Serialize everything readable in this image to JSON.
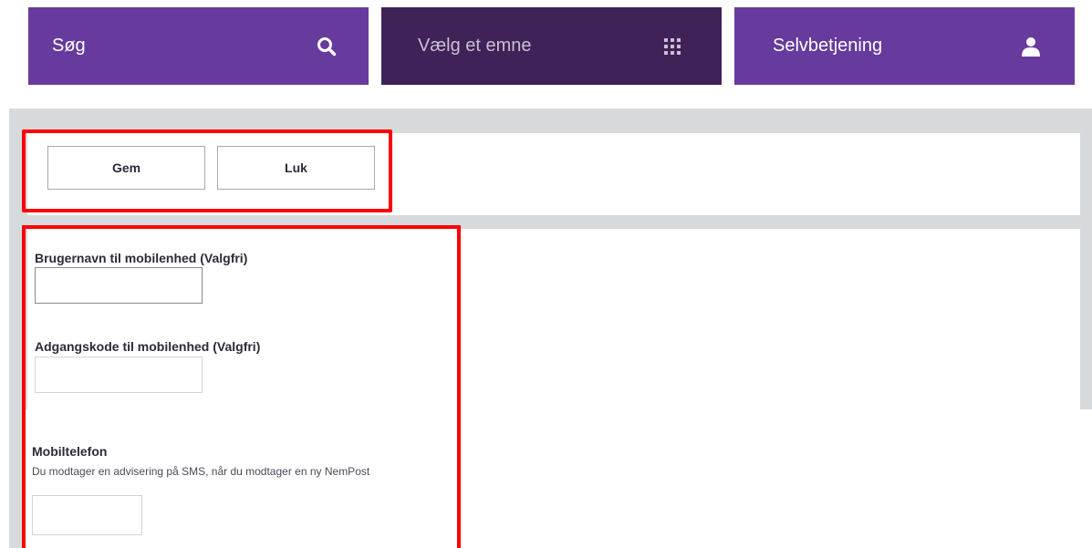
{
  "nav": {
    "search": {
      "label": "Søg",
      "icon": "search-icon"
    },
    "topic": {
      "label": "Vælg et emne",
      "icon": "grid-icon"
    },
    "self_service": {
      "label": "Selvbetjening",
      "icon": "user-icon"
    }
  },
  "toolbar": {
    "save_label": "Gem",
    "close_label": "Luk"
  },
  "form": {
    "username_label": "Brugernavn til mobilenhed (Valgfri)",
    "username_value": "",
    "password_label": "Adgangskode til mobilenhed (Valgfri)",
    "password_value": "",
    "mobile_label": "Mobiltelefon",
    "mobile_help": "Du modtager en advisering på SMS, når du modtager en ny NemPost",
    "mobile_value": ""
  },
  "colors": {
    "nav_purple": "#673a9d",
    "nav_dark_purple": "#3f2257",
    "annotation_red": "#ff0000",
    "background_grey": "#d7dadd"
  }
}
